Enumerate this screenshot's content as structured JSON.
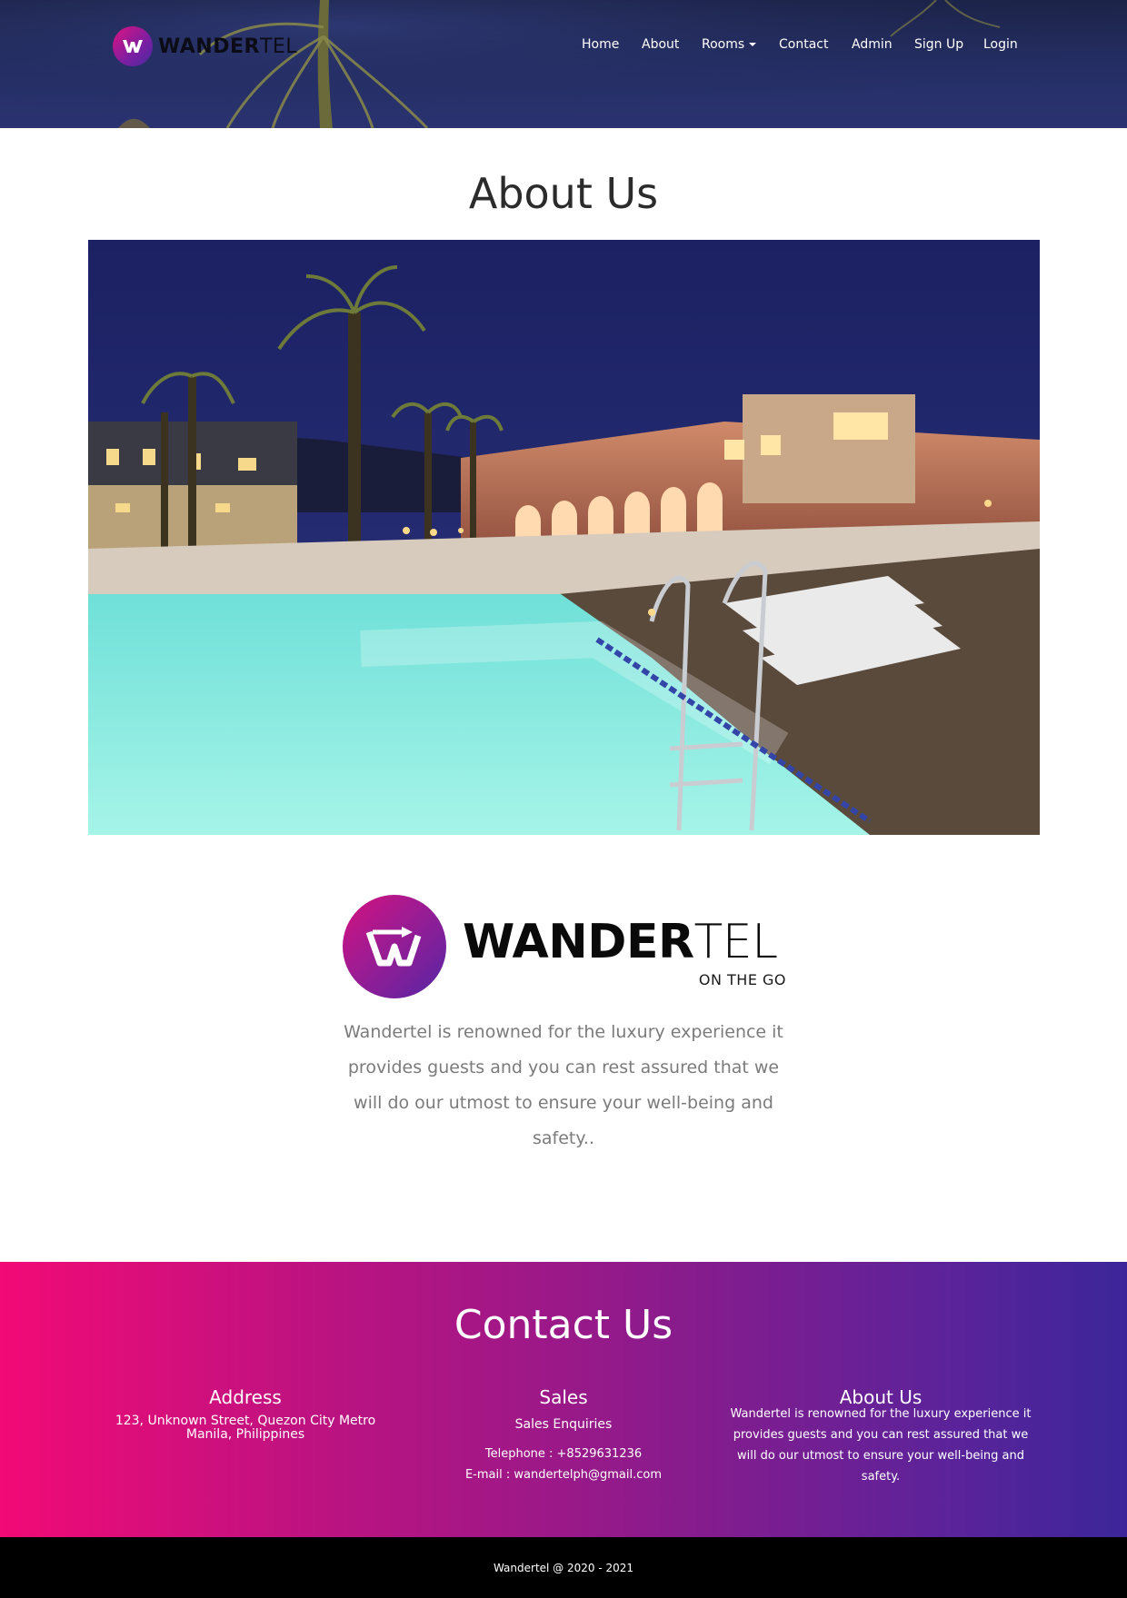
{
  "brand": {
    "name_bold": "WANDER",
    "name_light": "TEL",
    "tagline": "ON THE GO"
  },
  "nav": {
    "items": [
      {
        "label": "Home"
      },
      {
        "label": "About"
      },
      {
        "label": "Rooms"
      },
      {
        "label": "Contact"
      },
      {
        "label": "Admin"
      },
      {
        "label": "Sign Up"
      },
      {
        "label": "Login"
      }
    ]
  },
  "about": {
    "title": "About Us",
    "description": "Wandertel is renowned for the luxury experience it provides guests and you can rest assured that we will do our utmost to ensure your well-being and safety.."
  },
  "contact": {
    "title": "Contact Us",
    "address": {
      "heading": "Address",
      "text": "123, Unknown Street, Quezon City Metro Manila, Philippines"
    },
    "sales": {
      "heading": "Sales",
      "subheading": "Sales Enquiries",
      "telephone": "Telephone : +8529631236",
      "email": "E-mail : wandertelph@gmail.com"
    },
    "about": {
      "heading": "About Us",
      "text": "Wandertel is renowned for the luxury experience it provides guests and you can rest assured that we will do our utmost to ensure your well-being and safety."
    }
  },
  "footer": {
    "copyright": "Wandertel @ 2020 - 2021"
  },
  "colors": {
    "header_bg": "#252f66",
    "gradient_start": "#f20a76",
    "gradient_end": "#3b2699",
    "footer_bg": "#000000"
  }
}
